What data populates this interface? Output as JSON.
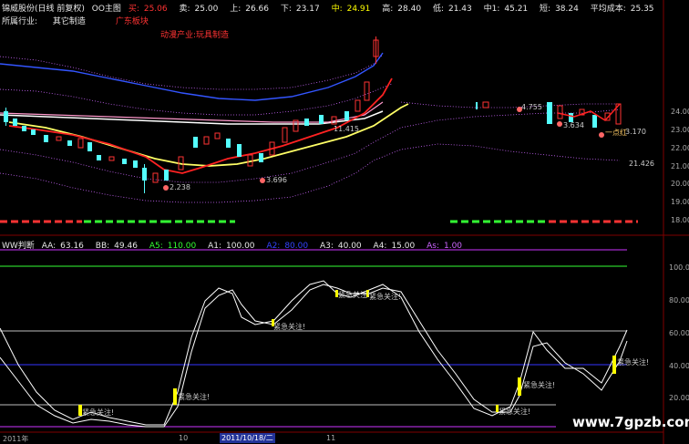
{
  "header": {
    "stock": "锦威股份(日线 前复权)",
    "chart_name": "OO主图",
    "buy_label": "买:",
    "buy_value": "25.06",
    "sell_label": "卖:",
    "sell_value": "25.00",
    "up_label": "上:",
    "up_value": "26.66",
    "down_label": "下:",
    "down_value": "23.17",
    "mid_label": "中:",
    "mid_value": "24.91",
    "high_label": "高:",
    "high_value": "28.40",
    "low_label": "低:",
    "low_value": "21.43",
    "mid2_label": "中1:",
    "mid2_value": "45.21",
    "short_label": "短:",
    "short_value": "38.24",
    "avgcost_label": "平均成本:",
    "avgcost_value": "25.35",
    "industry_label": "所属行业:",
    "industry_value": "其它制造",
    "region": "广东板块",
    "sector_label": "动漫产业:",
    "sector_value": "玩具制造"
  },
  "indicator": {
    "name": "WW判断",
    "aa_label": "AA:",
    "aa_value": "63.16",
    "bb_label": "BB:",
    "bb_value": "49.46",
    "a5_label": "A5:",
    "a5_value": "110.00",
    "a1_label": "A1:",
    "a1_value": "100.00",
    "a2_label": "A2:",
    "a2_value": "80.00",
    "a3_label": "A3:",
    "a3_value": "40.00",
    "a4_label": "A4:",
    "a4_value": "15.00",
    "as_label": "As:",
    "as_value": "1.00"
  },
  "price_axis": [
    "24.00",
    "23.00",
    "22.00",
    "21.00",
    "20.00",
    "19.00",
    "18.00"
  ],
  "ind_axis": [
    "100.00",
    "80.00",
    "60.00",
    "40.00",
    "20.00"
  ],
  "price_labels": {
    "p1": "2.238",
    "p2": "3.696",
    "p3": "11.415",
    "p4": "4.755",
    "p5": "3.634",
    "p6": "3.170",
    "p7": "21.426",
    "p8": "一点红"
  },
  "alert_text": "紧急关注!",
  "dates": {
    "d1": "2011年",
    "d2": "10",
    "d3": "2011/10/18/二",
    "d4": "11"
  },
  "watermark": "www.7gpzb.com",
  "colors": {
    "up": "#ff3333",
    "down": "#54ffff",
    "ma_white": "#ffffff",
    "ma_yellow": "#ffff66",
    "band": "#cc66ff",
    "blue": "#3333ff"
  }
}
